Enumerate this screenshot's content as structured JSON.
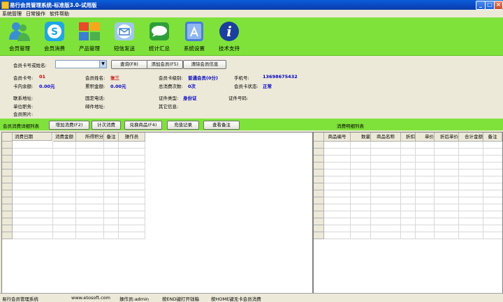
{
  "window": {
    "title": "易行会员管理系统-标准版3.0-试用版"
  },
  "menu": [
    "系统管理",
    "日常操作",
    "软件帮助"
  ],
  "toolbar": [
    {
      "label": "会员管理",
      "icon": "members-icon"
    },
    {
      "label": "会员消费",
      "icon": "skype-icon"
    },
    {
      "label": "产品管理",
      "icon": "blocks-icon"
    },
    {
      "label": "短信发送",
      "icon": "mail-icon"
    },
    {
      "label": "统计汇总",
      "icon": "chat-icon"
    },
    {
      "label": "系统设置",
      "icon": "appstore-icon"
    },
    {
      "label": "技术支持",
      "icon": "info-icon"
    }
  ],
  "search": {
    "label": "会员卡号或姓名:",
    "value": "",
    "query_btn": "查询(F8)",
    "add_btn": "添加会员(F5)",
    "clear_btn": "清除会员信息"
  },
  "info": {
    "card_no_label": "会员卡号:",
    "card_no": "01",
    "name_label": "会员姓名:",
    "name": "张三",
    "level_label": "会员卡级别:",
    "level": "普通会员(0分)",
    "phone_label": "手机号:",
    "phone": "13698675432",
    "balance_label": "卡内余额:",
    "balance": "0.00元",
    "accum_label": "累积金额:",
    "accum": "0.00元",
    "count_label": "总消费次数:",
    "count": "0次",
    "status_label": "会员卡状态:",
    "status": "正常",
    "address_label": "联系地址:",
    "fixed_phone_label": "固定电话:",
    "id_type_label": "证件类型:",
    "id_type": "身份证",
    "id_no_label": "证件号码:",
    "unit_label": "单位职务:",
    "postcode_label": "邮件地址:",
    "other_label": "其它信息:",
    "photo_label": "会员照片:"
  },
  "actions": {
    "list_title": "会员消费详细列表",
    "add_consume": "增加消费(F2)",
    "count_consume": "计次消费",
    "exchange": "兑换商品(F4)",
    "recharge": "充值记录",
    "view_notes": "查看备注",
    "detail_title": "消费明细列表"
  },
  "left_grid": {
    "columns": [
      "消费日期",
      "消费金额",
      "所得积分",
      "备注",
      "操作员"
    ]
  },
  "right_grid": {
    "columns": [
      "商品编号",
      "数量",
      "商品名称",
      "折扣",
      "单价",
      "折后单价",
      "合计金额",
      "备注"
    ]
  },
  "statusbar": {
    "app": "易行会员管理系统",
    "site": "www.etosoft.com",
    "operator": "操作员:admin",
    "hint1": "按END键打开钱箱",
    "hint2": "按HOME键无卡会员消费"
  }
}
